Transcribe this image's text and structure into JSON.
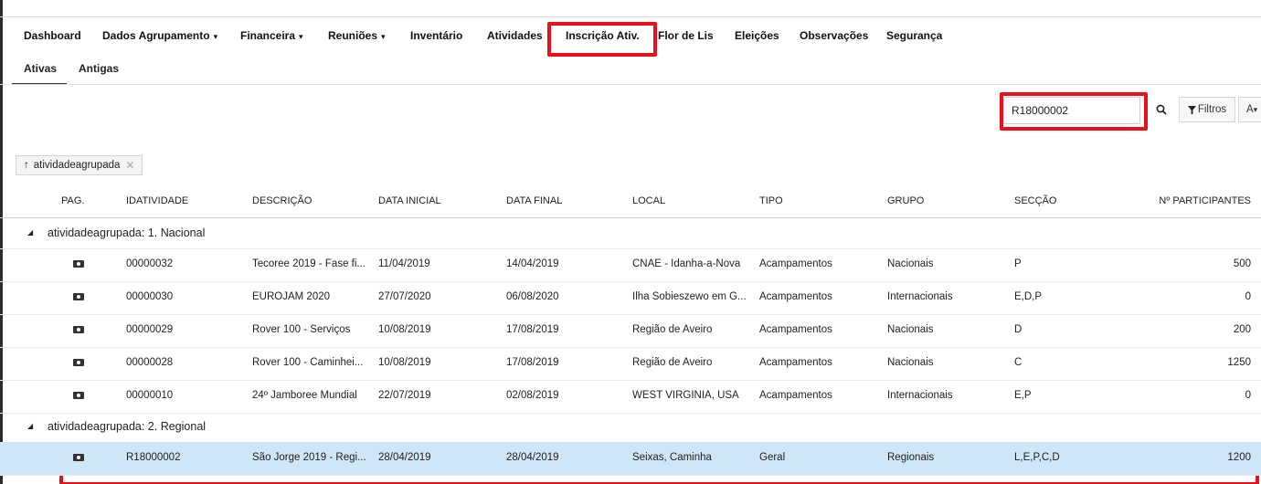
{
  "nav": {
    "items": [
      {
        "label": "Dashboard",
        "caret": false
      },
      {
        "label": "Dados Agrupamento",
        "caret": true
      },
      {
        "label": "Financeira",
        "caret": true
      },
      {
        "label": "Reuniões",
        "caret": true
      },
      {
        "label": "Inventário",
        "caret": false
      },
      {
        "label": "Atividades",
        "caret": false
      },
      {
        "label": "Inscrição Ativ.",
        "caret": false,
        "highlighted": true
      },
      {
        "label": "Flor de Lis",
        "caret": false
      },
      {
        "label": "Eleições",
        "caret": false
      },
      {
        "label": "Observações",
        "caret": false
      },
      {
        "label": "Segurança",
        "caret": false
      }
    ],
    "caret_glyph": "▾"
  },
  "subtabs": [
    {
      "label": "Ativas",
      "active": true
    },
    {
      "label": "Antigas",
      "active": false
    }
  ],
  "search": {
    "value": "R18000002",
    "filter_label": "Filtros",
    "more_label": "A"
  },
  "group_chip": {
    "label": "atividadeagrupada",
    "sort_glyph": "↑",
    "remove_glyph": "✕"
  },
  "table": {
    "columns": [
      "PAG.",
      "IDATIVIDADE",
      "DESCRIÇÃO",
      "DATA INICIAL",
      "DATA FINAL",
      "LOCAL",
      "TIPO",
      "GRUPO",
      "SECÇÃO",
      "Nº PARTICIPANTES"
    ],
    "groups": [
      {
        "label": "atividadeagrupada: 1. Nacional",
        "rows": [
          {
            "id": "00000032",
            "descricao": "Tecoree 2019 - Fase fi...",
            "data_inicial": "11/04/2019",
            "data_final": "14/04/2019",
            "local": "CNAE - Idanha-a-Nova",
            "tipo": "Acampamentos",
            "grupo": "Nacionais",
            "seccao": "P",
            "participantes": "500"
          },
          {
            "id": "00000030",
            "descricao": "EUROJAM 2020",
            "data_inicial": "27/07/2020",
            "data_final": "06/08/2020",
            "local": "Ilha Sobieszewo em G...",
            "tipo": "Acampamentos",
            "grupo": "Internacionais",
            "seccao": "E,D,P",
            "participantes": "0"
          },
          {
            "id": "00000029",
            "descricao": "Rover 100 - Serviços",
            "data_inicial": "10/08/2019",
            "data_final": "17/08/2019",
            "local": "Região de Aveiro",
            "tipo": "Acampamentos",
            "grupo": "Nacionais",
            "seccao": "D",
            "participantes": "200"
          },
          {
            "id": "00000028",
            "descricao": "Rover 100 - Caminhei...",
            "data_inicial": "10/08/2019",
            "data_final": "17/08/2019",
            "local": "Região de Aveiro",
            "tipo": "Acampamentos",
            "grupo": "Nacionais",
            "seccao": "C",
            "participantes": "1250"
          },
          {
            "id": "00000010",
            "descricao": "24º Jamboree Mundial",
            "data_inicial": "22/07/2019",
            "data_final": "02/08/2019",
            "local": "WEST VIRGINIA, USA",
            "tipo": "Acampamentos",
            "grupo": "Internacionais",
            "seccao": "E,P",
            "participantes": "0"
          }
        ]
      },
      {
        "label": "atividadeagrupada: 2. Regional",
        "rows": [
          {
            "id": "R18000002",
            "descricao": "São Jorge 2019 - Regi...",
            "data_inicial": "28/04/2019",
            "data_final": "28/04/2019",
            "local": "Seixas, Caminha",
            "tipo": "Geral",
            "grupo": "Regionais",
            "seccao": "L,E,P,C,D",
            "participantes": "1200",
            "selected": true
          }
        ]
      }
    ]
  }
}
